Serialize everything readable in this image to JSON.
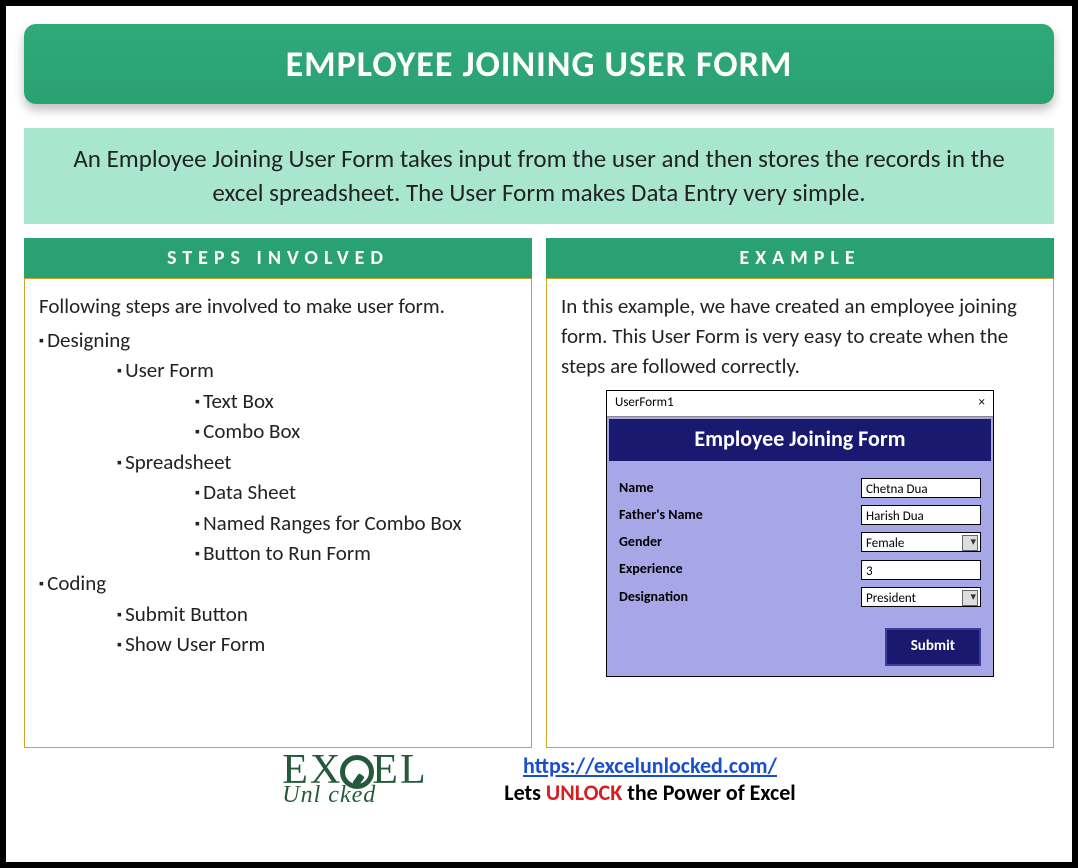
{
  "title": "EMPLOYEE JOINING USER FORM",
  "description": "An Employee Joining User Form takes input from the user and then stores the records in the excel spreadsheet. The User Form makes Data Entry very simple.",
  "left": {
    "heading": "STEPS INVOLVED",
    "intro": "Following steps are involved to make user form.",
    "items": {
      "designing": "Designing",
      "userform": "User Form",
      "textbox": "Text Box",
      "combobox": "Combo Box",
      "spreadsheet": "Spreadsheet",
      "datasheet": "Data Sheet",
      "namedranges": "Named Ranges for Combo Box",
      "buttonrun": "Button to Run Form",
      "coding": "Coding",
      "submitbtn": "Submit Button",
      "showuf": "Show User Form"
    }
  },
  "right": {
    "heading": "EXAMPLE",
    "intro": "In this example, we have created an employee joining form. This User Form is very easy to create when the steps are followed correctly."
  },
  "userform": {
    "window_title": "UserForm1",
    "close": "×",
    "heading": "Employee Joining Form",
    "labels": {
      "name": "Name",
      "father": "Father's Name",
      "gender": "Gender",
      "exp": "Experience",
      "desig": "Designation"
    },
    "values": {
      "name": "Chetna Dua",
      "father": "Harish Dua",
      "gender": "Female",
      "exp": "3",
      "desig": "President"
    },
    "submit": "Submit"
  },
  "footer": {
    "logo_top": "EX",
    "logo_top2": "EL",
    "logo_bottom": "Unl   cked",
    "url": "https://excelunlocked.com/",
    "tag_pre": "Lets ",
    "tag_unlock": "UNLOCK",
    "tag_post": " the Power of Excel"
  }
}
